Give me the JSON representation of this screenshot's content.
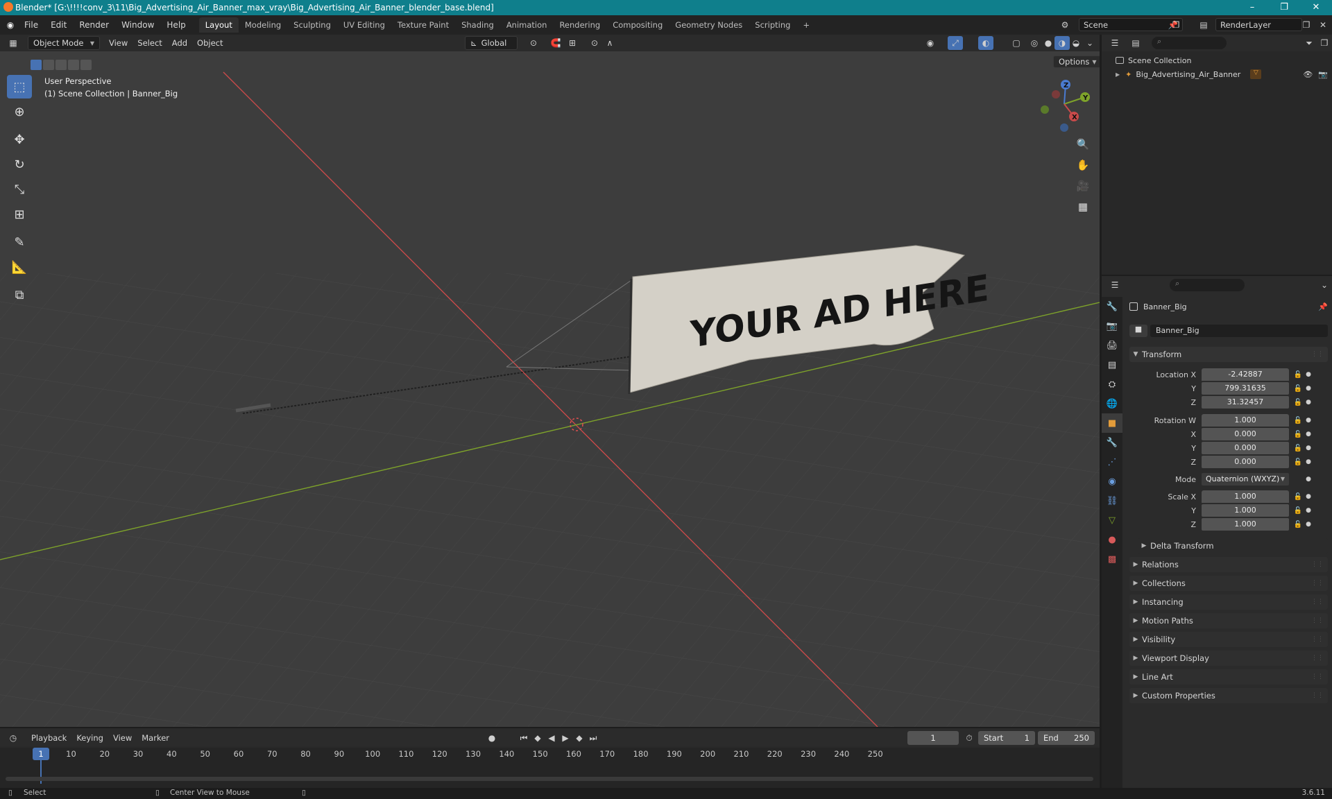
{
  "titlebar": {
    "title": "Blender* [G:\\!!!!conv_3\\11\\Big_Advertising_Air_Banner_max_vray\\Big_Advertising_Air_Banner_blender_base.blend]",
    "minimize": "–",
    "maximize": "❐",
    "close": "✕"
  },
  "menu": [
    "File",
    "Edit",
    "Render",
    "Window",
    "Help"
  ],
  "workspaces": [
    "Layout",
    "Modeling",
    "Sculpting",
    "UV Editing",
    "Texture Paint",
    "Shading",
    "Animation",
    "Rendering",
    "Compositing",
    "Geometry Nodes",
    "Scripting"
  ],
  "active_workspace": "Layout",
  "add_workspace": "+",
  "scene": {
    "name": "Scene",
    "render_layer": "RenderLayer"
  },
  "viewport_header": {
    "mode": "Object Mode",
    "menus": [
      "View",
      "Select",
      "Add",
      "Object"
    ],
    "orientation": "Global",
    "options": "Options"
  },
  "viewport": {
    "perspective_label": "User Perspective",
    "collection_label": "(1) Scene Collection | Banner_Big",
    "banner_text": "YOUR AD HERE",
    "gizmo_axes": {
      "x": "X",
      "y": "Y",
      "z": "Z"
    },
    "colors": {
      "x_axis": "#c94a4a",
      "y_axis": "#7ea32a",
      "grid_bg": "#3d3d3d",
      "active_tool": "#4772b3"
    }
  },
  "outliner": {
    "root": "Scene Collection",
    "items": [
      {
        "name": "Big_Advertising_Air_Banner"
      }
    ]
  },
  "properties": {
    "object_name": "Banner_Big",
    "data_name": "Banner_Big",
    "transform_title": "Transform",
    "location": {
      "label": "Location X",
      "x": "-2.42887",
      "y": "799.31635",
      "z": "31.32457"
    },
    "rotation": {
      "label": "Rotation W",
      "w": "1.000",
      "x": "0.000",
      "y": "0.000",
      "z": "0.000"
    },
    "mode_label": "Mode",
    "mode_value": "Quaternion (WXYZ)",
    "scale": {
      "label": "Scale X",
      "x": "1.000",
      "y": "1.000",
      "z": "1.000"
    },
    "axis_labels": {
      "y": "Y",
      "z": "Z",
      "x": "X"
    },
    "delta_transform": "Delta Transform",
    "panels": [
      "Relations",
      "Collections",
      "Instancing",
      "Motion Paths",
      "Visibility",
      "Viewport Display",
      "Line Art",
      "Custom Properties"
    ]
  },
  "timeline": {
    "menus": [
      "Playback",
      "Keying",
      "View",
      "Marker"
    ],
    "current_frame": "1",
    "start_label": "Start",
    "start": "1",
    "end_label": "End",
    "end": "250",
    "ticks": [
      "1",
      "10",
      "20",
      "30",
      "40",
      "50",
      "60",
      "70",
      "80",
      "90",
      "100",
      "110",
      "120",
      "130",
      "140",
      "150",
      "160",
      "170",
      "180",
      "190",
      "200",
      "210",
      "220",
      "230",
      "240",
      "250"
    ]
  },
  "statusbar": {
    "select": "Select",
    "center_view": "Center View to Mouse",
    "version": "3.6.11"
  }
}
